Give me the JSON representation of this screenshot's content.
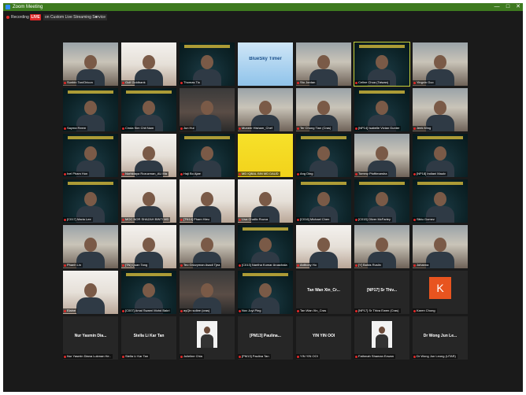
{
  "window": {
    "title": "Zoom Meeting"
  },
  "window_controls": {
    "minimize": "—",
    "maximize": "□",
    "close": "✕"
  },
  "toolbar": {
    "recording_label": "Recording",
    "live_badge": "LIVE",
    "stream_label": "on Custom Live Streaming Service",
    "stream_caret": "▾"
  },
  "tiles": [
    {
      "name": "Sunbin Tan/Oricon",
      "scene": "person-office"
    },
    {
      "name": "Gulf Goldbank",
      "scene": "person-white"
    },
    {
      "name": "Thomas Tio",
      "scene": "banner"
    },
    {
      "name": "",
      "scene": "timer",
      "center": "BlueSky Timer"
    },
    {
      "name": "Stu Jordan",
      "scene": "person-office"
    },
    {
      "name": "Celine Chua (Taiwan)",
      "scene": "banner",
      "active": true
    },
    {
      "name": "Yingxin Guo",
      "scene": "person-office"
    },
    {
      "name": "Sayma Reem",
      "scene": "banner"
    },
    {
      "name": "Cinda Sim Chit Nam",
      "scene": "banner"
    },
    {
      "name": "Jun Hui",
      "scene": "person-dark"
    },
    {
      "name": "Muneer Hisham_Chef",
      "scene": "person-office"
    },
    {
      "name": "Ter Chong Tian (Cras)",
      "scene": "person-office"
    },
    {
      "name": "[NP14] Isabelle Vivian Gunter",
      "scene": "banner"
    },
    {
      "name": "Jeek Ming",
      "scene": "person-office"
    },
    {
      "name": "Ivel Pham Hon",
      "scene": "banner"
    },
    {
      "name": "Norhidaya Rozuzman_AU Ma",
      "scene": "person-white"
    },
    {
      "name": "Haji Bo Ajae",
      "scene": "banner"
    },
    {
      "name": "MD IQBAL BIN MD DAUD",
      "scene": "slide"
    },
    {
      "name": "Ang Ding",
      "scene": "banner"
    },
    {
      "name": "Tommy Ptoftimarsha",
      "scene": "person-office"
    },
    {
      "name": "[NP18] Indiani Maulv",
      "scene": "banner"
    },
    {
      "name": "[C017] Maria Lee",
      "scene": "banner"
    },
    {
      "name": "MOC NOR SHAZAH BINTI MD",
      "scene": "person-white"
    },
    {
      "name": "[TN14] Pham Hieu",
      "scene": "person-white"
    },
    {
      "name": "Lisa Chaillo Ruzca",
      "scene": "person-white"
    },
    {
      "name": "[C016] Michael Chen",
      "scene": "banner"
    },
    {
      "name": "[C015] Oliver McFarley",
      "scene": "banner"
    },
    {
      "name": "Siktu Gomez",
      "scene": "banner"
    },
    {
      "name": "Phanh Lin",
      "scene": "person-office"
    },
    {
      "name": "[TN] Quan Tang",
      "scene": "person-white"
    },
    {
      "name": "Teo Grizzyman Asadi Tjea",
      "scene": "person-office"
    },
    {
      "name": "[C013] Nantha Kumar Aruachala",
      "scene": "banner"
    },
    {
      "name": "Anthony Ho",
      "scene": "person-white"
    },
    {
      "name": "[Y] Balkis Ruslin",
      "scene": "person-office"
    },
    {
      "name": "Johanna",
      "scene": "person-office"
    },
    {
      "name": "Elaine",
      "scene": "person-white"
    },
    {
      "name": "[C007] Amal Swarni Mohd Bakri",
      "scene": "banner"
    },
    {
      "name": "ayQin sollee (cras)",
      "scene": "person-dark"
    },
    {
      "name": "Nov Juyi Ping",
      "scene": "banner"
    },
    {
      "name": "Tan Wan Xin_Cras",
      "scene": "text",
      "center": "Tan Wan Xin_Cr..."
    },
    {
      "name": "[NP17] Sr Thiva Ewen (Cras)",
      "scene": "text",
      "center": "[NP17] Sr Thiv..."
    },
    {
      "name": "Karen Chong",
      "scene": "avatarK",
      "avatar_letter": "K"
    },
    {
      "name": "Nur Yasmin Diana Lukman He..",
      "scene": "text",
      "center": "Nur Yasmin Dia..."
    },
    {
      "name": "Stella Li Kar Tan",
      "scene": "text",
      "center": "Stella Li Kar Tan"
    },
    {
      "name": "Julieline Chia",
      "scene": "avatar-photo"
    },
    {
      "name": "[PM13] Paulina Tan",
      "scene": "text",
      "center": "[PM13] Paulina..."
    },
    {
      "name": "YIN YIN OOI",
      "scene": "text",
      "center": "YIN YIN OOI"
    },
    {
      "name": "Fathmah Shaman Ezwan",
      "scene": "avatar-photo"
    },
    {
      "name": "Dr Wong Jun Leong (UTAR)",
      "scene": "text",
      "center": "Dr Wong Jun Le..."
    }
  ]
}
